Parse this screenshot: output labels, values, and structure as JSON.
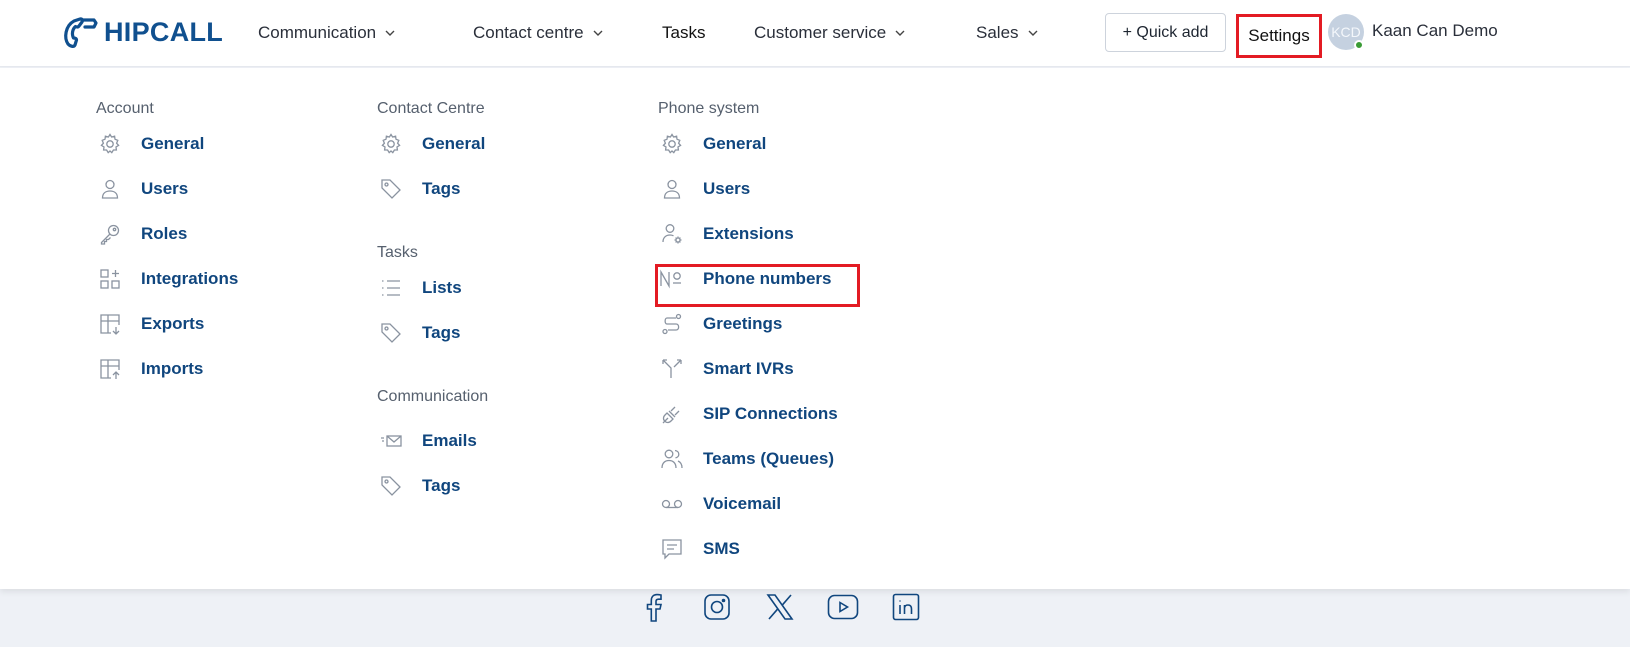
{
  "brand": {
    "name": "HIPCALL",
    "color": "#10508f"
  },
  "nav": {
    "communication": "Communication",
    "contact_centre": "Contact centre",
    "tasks": "Tasks",
    "customer_service": "Customer service",
    "sales": "Sales"
  },
  "header": {
    "quick_add": "+ Quick add",
    "settings": "Settings",
    "avatar_initials": "KCD",
    "user_name": "Kaan Can Demo"
  },
  "menu": {
    "account": {
      "title": "Account",
      "items": [
        {
          "label": "General",
          "icon": "gear-icon"
        },
        {
          "label": "Users",
          "icon": "user-icon"
        },
        {
          "label": "Roles",
          "icon": "key-icon"
        },
        {
          "label": "Integrations",
          "icon": "integrations-icon"
        },
        {
          "label": "Exports",
          "icon": "export-icon"
        },
        {
          "label": "Imports",
          "icon": "import-icon"
        }
      ]
    },
    "contact_centre": {
      "title": "Contact Centre",
      "items": [
        {
          "label": "General",
          "icon": "gear-icon"
        },
        {
          "label": "Tags",
          "icon": "tag-icon"
        }
      ]
    },
    "tasks": {
      "title": "Tasks",
      "items": [
        {
          "label": "Lists",
          "icon": "list-icon"
        },
        {
          "label": "Tags",
          "icon": "tag-icon"
        }
      ]
    },
    "communication": {
      "title": "Communication",
      "items": [
        {
          "label": "Emails",
          "icon": "email-icon"
        },
        {
          "label": "Tags",
          "icon": "tag-icon"
        }
      ]
    },
    "phone_system": {
      "title": "Phone system",
      "items": [
        {
          "label": "General",
          "icon": "gear-icon"
        },
        {
          "label": "Users",
          "icon": "user-icon"
        },
        {
          "label": "Extensions",
          "icon": "user-settings-icon"
        },
        {
          "label": "Phone numbers",
          "icon": "numero-sign-icon"
        },
        {
          "label": "Greetings",
          "icon": "route-icon"
        },
        {
          "label": "Smart IVRs",
          "icon": "split-icon"
        },
        {
          "label": "SIP Connections",
          "icon": "plug-icon"
        },
        {
          "label": "Teams (Queues)",
          "icon": "users-icon"
        },
        {
          "label": "Voicemail",
          "icon": "voicemail-icon"
        },
        {
          "label": "SMS",
          "icon": "message-icon"
        }
      ]
    }
  },
  "footer": {
    "social": [
      "facebook-icon",
      "instagram-icon",
      "x-icon",
      "youtube-icon",
      "linkedin-icon"
    ]
  },
  "colors": {
    "link": "#10467e",
    "highlight": "#e31b23",
    "icon": "#8a93a0",
    "footer_bg": "#eef1f6"
  }
}
